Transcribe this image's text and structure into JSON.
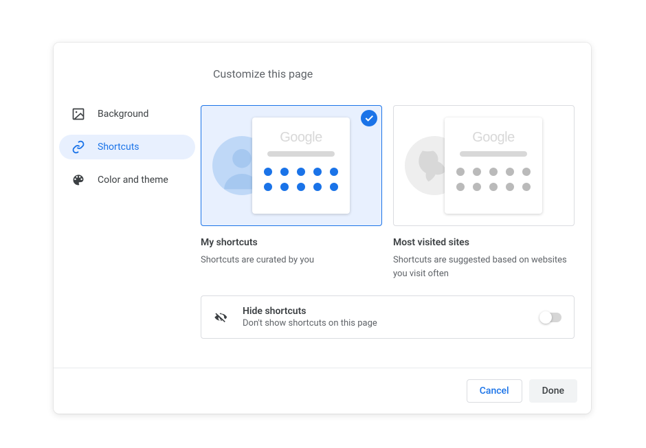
{
  "title": "Customize this page",
  "sidebar": {
    "items": [
      {
        "label": "Background"
      },
      {
        "label": "Shortcuts"
      },
      {
        "label": "Color and theme"
      }
    ]
  },
  "options": {
    "my_shortcuts": {
      "title": "My shortcuts",
      "description": "Shortcuts are curated by you",
      "selected": true,
      "dot_color": "#1a73e8",
      "logo_text": "Google"
    },
    "most_visited": {
      "title": "Most visited sites",
      "description": "Shortcuts are suggested based on websites you visit often",
      "selected": false,
      "dot_color": "#bababa",
      "logo_text": "Google"
    }
  },
  "hide_shortcuts": {
    "title": "Hide shortcuts",
    "description": "Don't show shortcuts on this page",
    "enabled": false
  },
  "buttons": {
    "cancel": "Cancel",
    "done": "Done"
  }
}
